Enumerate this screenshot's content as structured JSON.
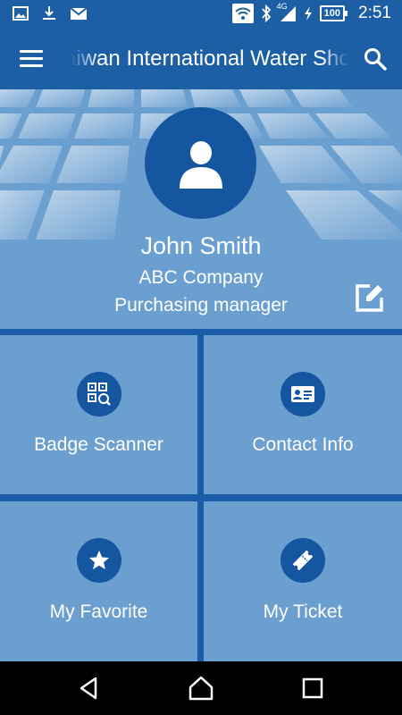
{
  "status_bar": {
    "time": "2:51",
    "battery": "100",
    "network": "4G",
    "left_icons": [
      "image-icon",
      "download-icon",
      "mail-icon"
    ],
    "right_icons": [
      "wifi-icon",
      "bluetooth-icon",
      "signal-icon",
      "charging-icon"
    ]
  },
  "app_bar": {
    "title": "Taiwan International Water Show",
    "menu_icon": "hamburger-menu-icon",
    "search_icon": "search-icon"
  },
  "profile": {
    "name": "John Smith",
    "company": "ABC Company",
    "title": "Purchasing manager",
    "avatar_icon": "person-icon",
    "edit_icon": "edit-icon"
  },
  "tiles": [
    {
      "label": "Badge Scanner",
      "icon": "qr-scan-icon"
    },
    {
      "label": "Contact Info",
      "icon": "contact-card-icon"
    },
    {
      "label": "My Favorite",
      "icon": "star-icon"
    },
    {
      "label": "My Ticket",
      "icon": "ticket-icon"
    }
  ],
  "nav": {
    "back_icon": "back-triangle-icon",
    "home_icon": "home-icon",
    "recent_icon": "recent-apps-icon"
  },
  "colors": {
    "primary": "#1d5fa5",
    "tile": "#6b9fd0",
    "icon_circle": "#1556a0",
    "nav": "#000000"
  }
}
